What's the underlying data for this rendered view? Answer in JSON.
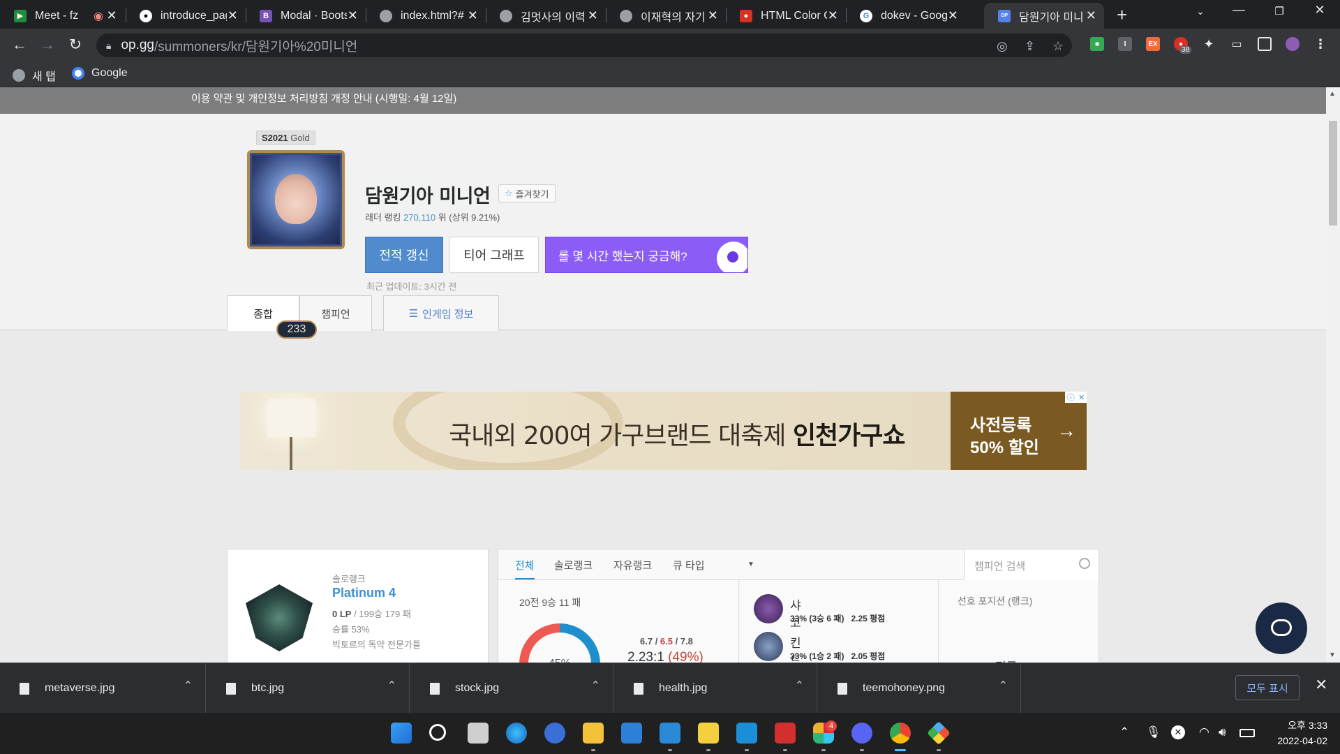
{
  "browser": {
    "tabs": [
      {
        "title": "Meet - fz",
        "icon": "google-meet-icon",
        "color": "#1e8e3e"
      },
      {
        "title": "introduce_pag",
        "icon": "github-icon",
        "color": "#ffffff"
      },
      {
        "title": "Modal · Boots",
        "icon": "bootstrap-icon",
        "color": "#7952b3"
      },
      {
        "title": "index.html?#",
        "icon": "globe-icon",
        "color": "#9aa0a6"
      },
      {
        "title": "김멋사의 이력",
        "icon": "globe-icon",
        "color": "#9aa0a6"
      },
      {
        "title": "이재혁의 자기",
        "icon": "globe-icon",
        "color": "#9aa0a6"
      },
      {
        "title": "HTML Color C",
        "icon": "color-picker-icon",
        "color": "#d93025"
      },
      {
        "title": "dokev - Goog",
        "icon": "google-icon",
        "color": "#4285f4"
      },
      {
        "title": "담원기아 미니",
        "icon": "opgg-icon",
        "color": "#5383e8"
      }
    ],
    "url_host": "op.gg",
    "url_path": "/summoners/kr/담원기아%20미니언",
    "bookmarks": [
      {
        "label": "새 탭",
        "icon": "globe-icon"
      },
      {
        "label": "Google",
        "icon": "google-icon"
      }
    ],
    "ext_badge": "38"
  },
  "page": {
    "notice": "이용 약관 및 개인정보 처리방침 개정 안내 (시행일: 4월 12일)",
    "season_badge_season": "S2021",
    "season_badge_tier": "Gold",
    "level": "233",
    "summoner_name": "담원기아 미니언",
    "favorite_label": "즐겨찾기",
    "ladder_prefix": "래더 랭킹",
    "ladder_rank": "270,110",
    "ladder_suffix": "위 (상위 9.21%)",
    "btn_refresh": "전적 갱신",
    "btn_tier_graph": "티어 그래프",
    "btn_promo": "롤 몇 시간 했는지 궁금해?",
    "last_update": "최근 업데이트: 3시간 전",
    "subtabs": [
      "종합",
      "챔피언",
      "인게임 정보"
    ],
    "ad": {
      "text_regular": "국내외 200여 가구브랜드 대축제 ",
      "text_bold": "인천가구쇼",
      "cta_line1": "사전등록",
      "cta_line2": "50% 할인",
      "cta_arrow": "→"
    },
    "rank": {
      "queue": "솔로랭크",
      "tier": "Platinum 4",
      "lp": "0 LP",
      "record": " / 199승 179 패",
      "winrate": "승률 53%",
      "team": "빅토르의 독약 전문가들"
    },
    "stats": {
      "tabs": [
        "전체",
        "솔로랭크",
        "자유랭크",
        "큐 타입"
      ],
      "search_placeholder": "챔피언 검색",
      "summary": "20전 9승 11 패",
      "winrate_pct": "45%",
      "winrate_value": 45,
      "kda_kills": "6.7",
      "kda_deaths": "6.5",
      "kda_assists": "7.8",
      "kda_ratio": "2.23:1",
      "kp": "(49%)",
      "champions": [
        {
          "name": "샤코",
          "detail": "33% (3승 6 패)",
          "kda": "2.25 평점",
          "color": "#5b3a7a"
        },
        {
          "name": "킨드레드",
          "detail": "33% (1승 2 패)",
          "kda": "2.05 평점",
          "color": "#3a4f78"
        }
      ],
      "position_header": "선호 포지션 (랭크)",
      "position": "정글"
    }
  },
  "downloads": {
    "files": [
      "metaverse.jpg",
      "btc.jpg",
      "stock.jpg",
      "health.jpg",
      "teemohoney.png"
    ],
    "show_all": "모두 표시"
  },
  "taskbar": {
    "time": "오후 3:33",
    "date": "2022-04-02",
    "slack_badge": "4"
  }
}
